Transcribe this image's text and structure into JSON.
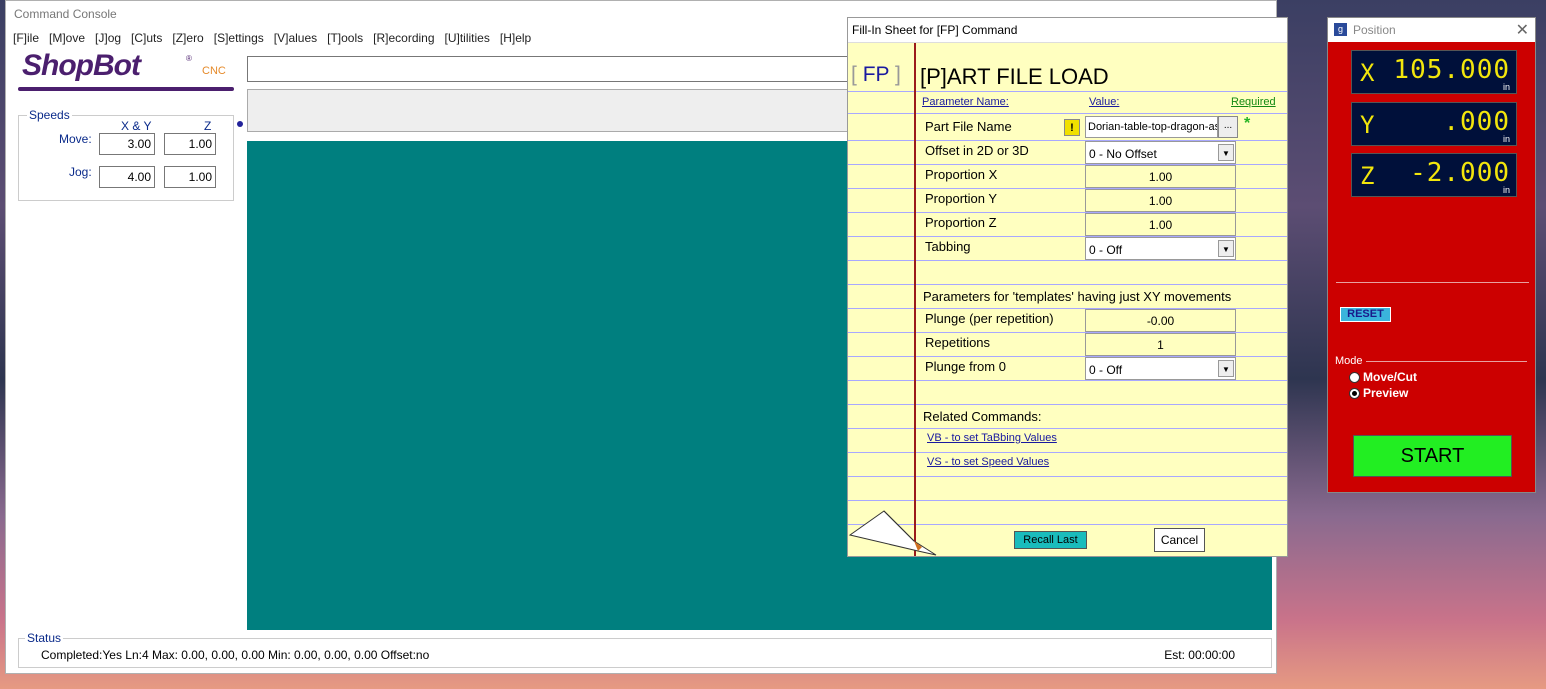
{
  "console": {
    "title": "Command Console",
    "menu": [
      "[F]ile",
      "[M]ove",
      "[J]og",
      "[C]uts",
      "[Z]ero",
      "[S]ettings",
      "[V]alues",
      "[T]ools",
      "[R]ecording",
      "[U]tilities",
      "[H]elp"
    ],
    "logo_text": "ShopBot",
    "logo_reg": "®",
    "logo_cnc": "CNC",
    "speeds": {
      "legend": "Speeds",
      "col_xy": "X & Y",
      "col_z": "Z",
      "move_label": "Move:",
      "jog_label": "Jog:",
      "move_xy": "3.00",
      "move_z": "1.00",
      "jog_xy": "4.00",
      "jog_z": "1.00"
    },
    "status": {
      "legend": "Status",
      "text": "Completed:Yes Ln:4 Max: 0.00, 0.00, 0.00  Min: 0.00, 0.00, 0.00  Offset:no",
      "est": "Est: 00:00:00"
    },
    "preview_color": "#007f7f"
  },
  "fillin": {
    "title": "Fill-In Sheet for [FP] Command",
    "cmd_open": "[",
    "cmd": "FP",
    "cmd_close": "]",
    "heading": "[P]ART FILE LOAD",
    "col_param": "Parameter Name:",
    "col_value": "Value:",
    "col_required": "Required",
    "rows": {
      "file_name": {
        "label": "Part File Name",
        "value": "Dorian-table-top-dragon-asp",
        "browse": "...",
        "warn": "!",
        "required_mark": "*"
      },
      "offset": {
        "label": "Offset in 2D or 3D",
        "value": "0 - No Offset"
      },
      "prop_x": {
        "label": "Proportion X",
        "value": "1.00"
      },
      "prop_y": {
        "label": "Proportion Y",
        "value": "1.00"
      },
      "prop_z": {
        "label": "Proportion Z",
        "value": "1.00"
      },
      "tabbing": {
        "label": "Tabbing",
        "value": "0 - Off"
      },
      "plunge": {
        "label": "Plunge (per repetition)",
        "value": "-0.00"
      },
      "reps": {
        "label": "Repetitions",
        "value": "1"
      },
      "plunge0": {
        "label": "Plunge from 0",
        "value": "0 - Off"
      }
    },
    "templates_note": "Parameters for 'templates' having just XY movements",
    "related_label": "Related Commands:",
    "link_vb": "VB - to set TaBbing Values",
    "link_vs": "VS - to set Speed Values",
    "recall_btn": "Recall Last",
    "cancel_btn": "Cancel"
  },
  "position": {
    "title": "Position",
    "icon": "g",
    "x_label": "X",
    "x_value": "105.000",
    "y_label": "Y",
    "y_value": ".000",
    "z_label": "Z",
    "z_value": "-2.000",
    "unit": "in",
    "reset_btn": "RESET",
    "mode_label": "Mode",
    "mode_options": [
      "Move/Cut",
      "Preview"
    ],
    "mode_selected": "Preview",
    "start_btn": "START",
    "accent": "#cc0000",
    "dro_color": "#f2e60c"
  }
}
